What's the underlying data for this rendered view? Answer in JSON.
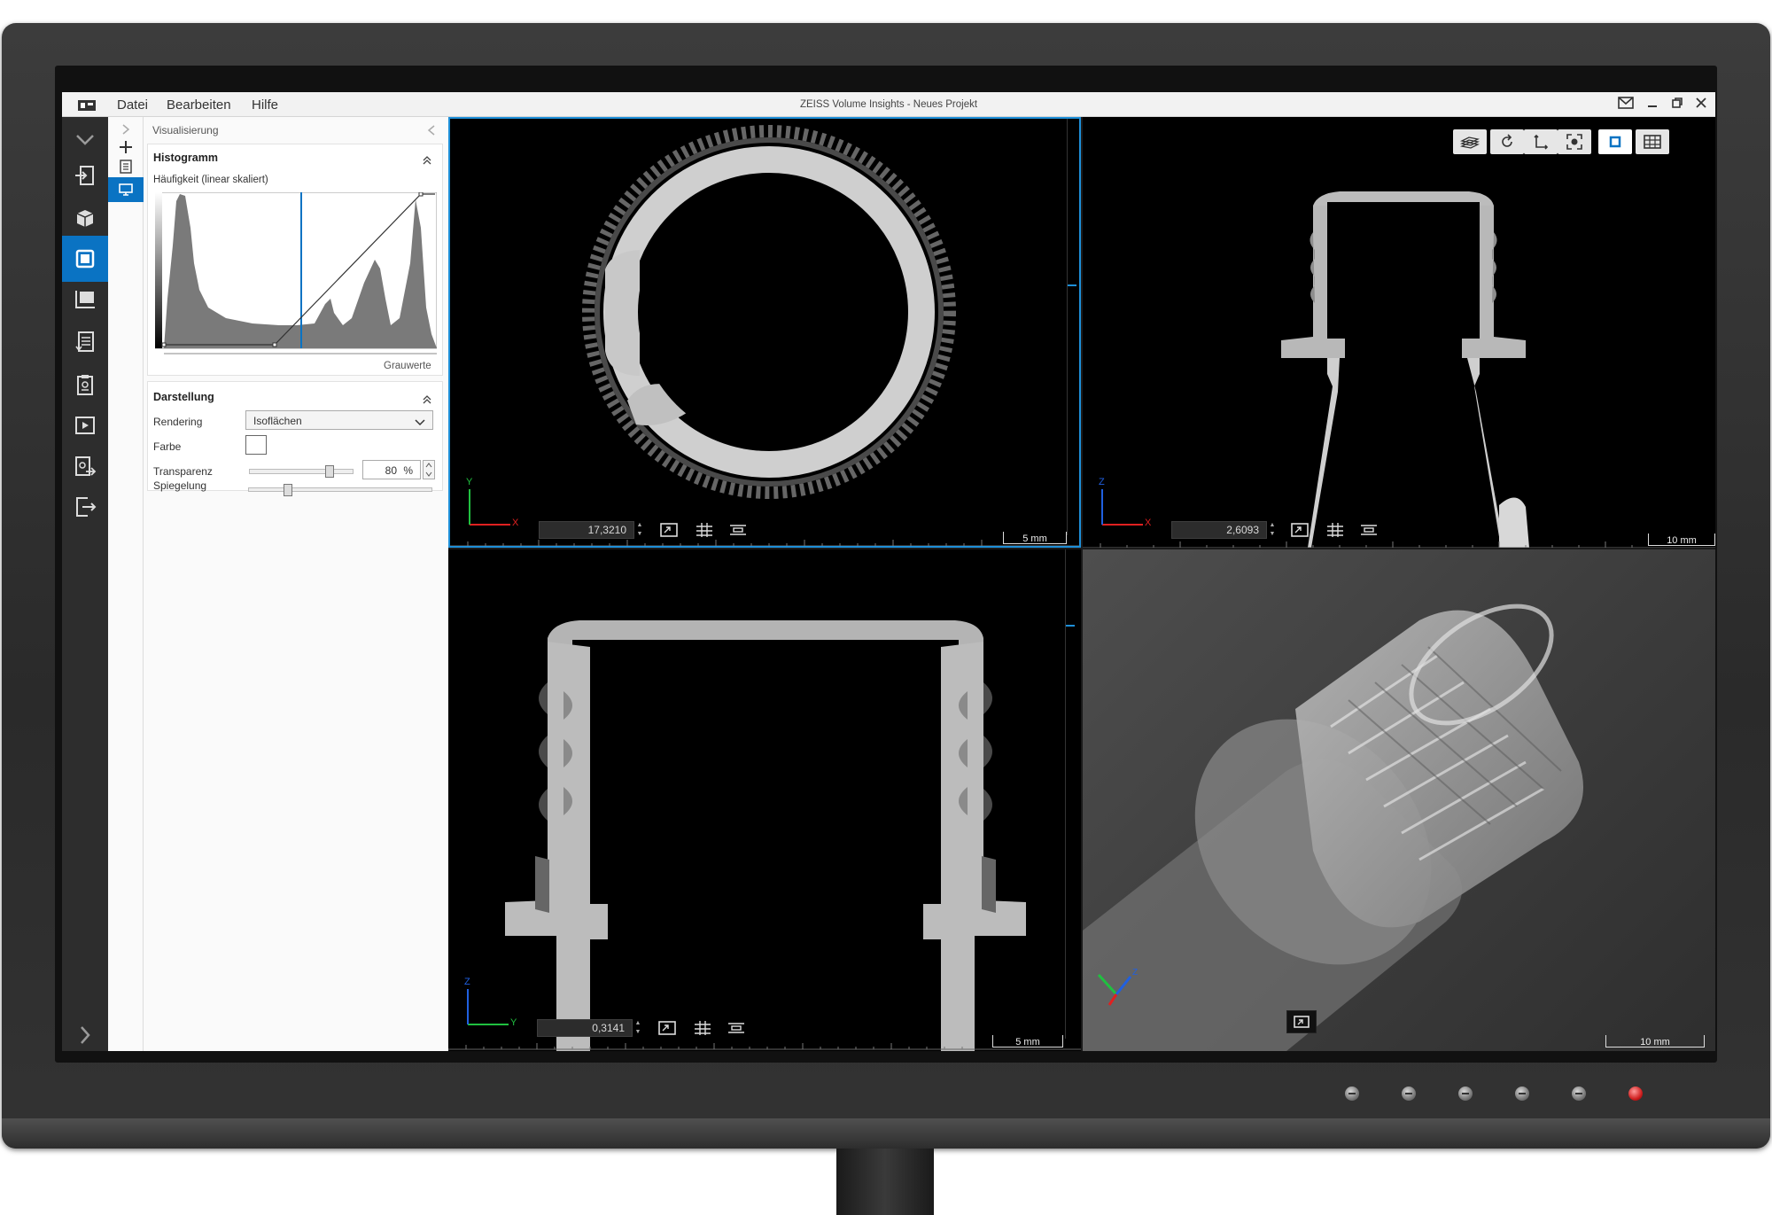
{
  "window": {
    "title": "ZEISS Volume Insights - Neues Projekt"
  },
  "menu": {
    "items": [
      "Datei",
      "Bearbeiten",
      "Hilfe"
    ]
  },
  "panel": {
    "header": "Visualisierung",
    "histogram": {
      "title": "Histogramm",
      "subtitle": "Häufigkeit (linear skaliert)",
      "xlabel": "Grauwerte"
    },
    "display": {
      "title": "Darstellung",
      "rendering_label": "Rendering",
      "rendering_value": "Isoflächen",
      "color_label": "Farbe",
      "transparency_label": "Transparenz",
      "transparency_value": "80",
      "transparency_unit": "%",
      "transparency_fraction": 0.8,
      "reflection_label": "Spiegelung",
      "reflection_fraction": 0.2
    }
  },
  "viewports": {
    "top_left": {
      "coord": "17,3210",
      "scale": "5 mm",
      "axis_h": "X",
      "axis_v": "Y"
    },
    "top_right": {
      "coord": "2,6093",
      "scale": "10 mm",
      "axis_h": "X",
      "axis_v": "Z"
    },
    "bottom_left": {
      "coord": "0,3141",
      "scale": "5 mm",
      "axis_h": "Y",
      "axis_v": "Z"
    },
    "bottom_right": {
      "scale": "10 mm"
    }
  },
  "colors": {
    "accent": "#0a73c3",
    "axis_x": "#e02020",
    "axis_y": "#20c040",
    "axis_z": "#2060e0",
    "power": "#d02020"
  }
}
